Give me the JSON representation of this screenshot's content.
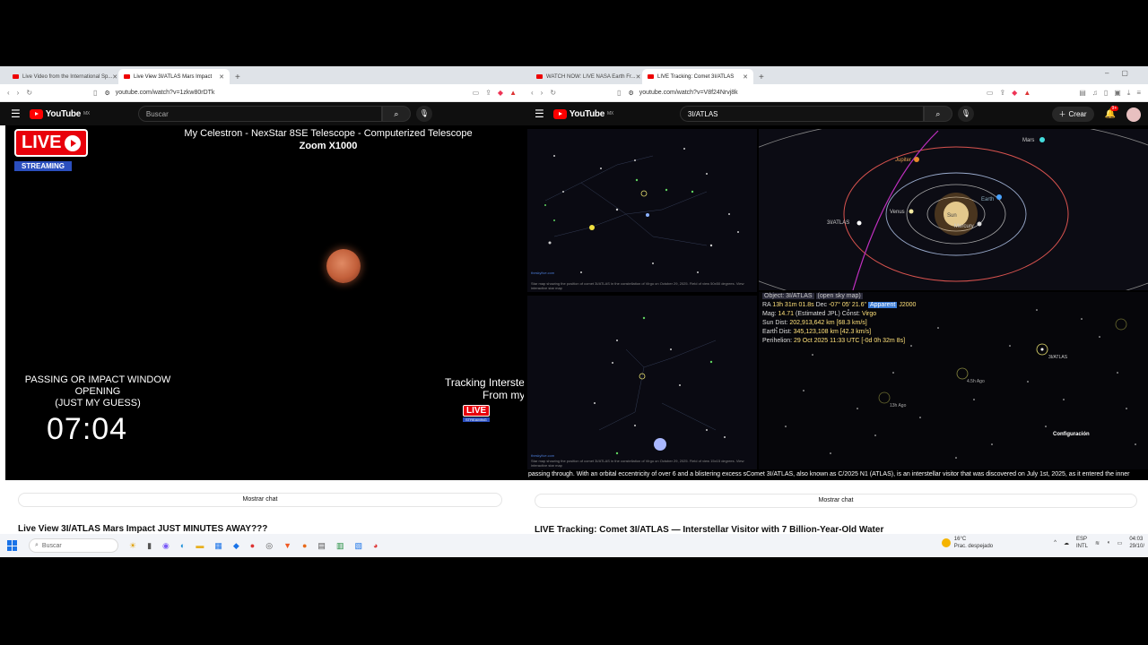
{
  "left": {
    "tabs": [
      {
        "label": "Live Video from the International Sp...",
        "active": false
      },
      {
        "label": "Live View 3I/ATLAS Mars Impact",
        "active": true
      }
    ],
    "url": "youtube.com/watch?v=1zkw80rDTk",
    "search_placeholder": "Buscar",
    "video_title_1": "My Celestron - NexStar 8SE Telescope - Computerized Telescope",
    "video_title_2": "Zoom X1000",
    "live_label": "LIVE",
    "streaming_label": "STREAMING",
    "passing_text": [
      "PASSING OR IMPACT WINDOW",
      "OPENING",
      "(JUST MY GUESS)"
    ],
    "clock": "07:04",
    "tracking_text": [
      "Tracking Interstell",
      "From my"
    ],
    "mini_live": "LIVE",
    "mini_streaming": "STREAMING",
    "chat_button": "Mostrar chat",
    "page_title": "Live View 3I/ATLAS Mars Impact JUST MINUTES AWAY???"
  },
  "right": {
    "tabs": [
      {
        "label": "WATCH NOW: LIVE NASA Earth Fr...",
        "active": false
      },
      {
        "label": "LIVE Tracking: Comet 3I/ATLAS",
        "active": true
      }
    ],
    "url": "youtube.com/watch?v=V8f24Nrvj8k",
    "search_value": "3I/ATLAS",
    "create_label": "Crear",
    "notif_count": "9+",
    "skymap_site": "theskylive.com",
    "skymap_caption_1": "Star map showing the position of comet 3I/ATLAS in the constellation of Virgo on October 29, 2025. Field of view 50x50 degrees. View interactive star map",
    "skymap_caption_2": "Star map showing the position of comet 3I/ATLAS in the constellation of Virgo on October 29, 2025. Field of view 15x15 degrees. View interactive star map",
    "orbit_labels": {
      "jupiter": "Jupiter",
      "earth": "Earth",
      "venus": "Venus",
      "mercury": "Mercury",
      "sun": "Sun",
      "comet": "3I/ATLAS",
      "mars": "Mars"
    },
    "info": {
      "object": "Object: 3I/ATLAS",
      "object_link": "(open sky map)",
      "ra_prefix": "RA",
      "ra": "13h 31m 01.8s",
      "dec_prefix": "Dec",
      "dec": "-07° 05' 21.6\"",
      "epoch_tag": "Apparent",
      "epoch": "J2000",
      "mag_prefix": "Mag:",
      "mag": "14.71",
      "mag_note": "(Estimated JPL)",
      "const_prefix": "Const:",
      "const": "Virgo",
      "sun_prefix": "Sun Dist:",
      "sun_dist": "202,913,642 km [68.3 km/s]",
      "earth_prefix": "Earth Dist:",
      "earth_dist": "345,123,108 km [42.3 km/s]",
      "peri_prefix": "Perihelion:",
      "perihelion": "29 Oct 2025 11:33 UTC [-0d 0h 32m 8s]"
    },
    "star_labels": {
      "atlas": "3I/ATLAS",
      "a1": "4.5h Ago",
      "a2": "13h Ago"
    },
    "config": "Configuración",
    "ticker": "passing through. With an orbital eccentricity of over 6 and a blistering excess sComet 3I/ATLAS, also known as C/2025 N1 (ATLAS), is an interstellar visitor that was discovered on July 1st, 2025, as it entered the inner",
    "chat_button": "Mostrar chat",
    "page_title": "LIVE Tracking: Comet 3I/ATLAS — Interstellar Visitor with 7 Billion-Year-Old Water"
  },
  "taskbar": {
    "search": "Buscar",
    "temp": "16°C",
    "weather": "Prac. despejado",
    "lang1": "ESP",
    "lang2": "INTL",
    "time": "04:03",
    "date": "29/10/"
  }
}
